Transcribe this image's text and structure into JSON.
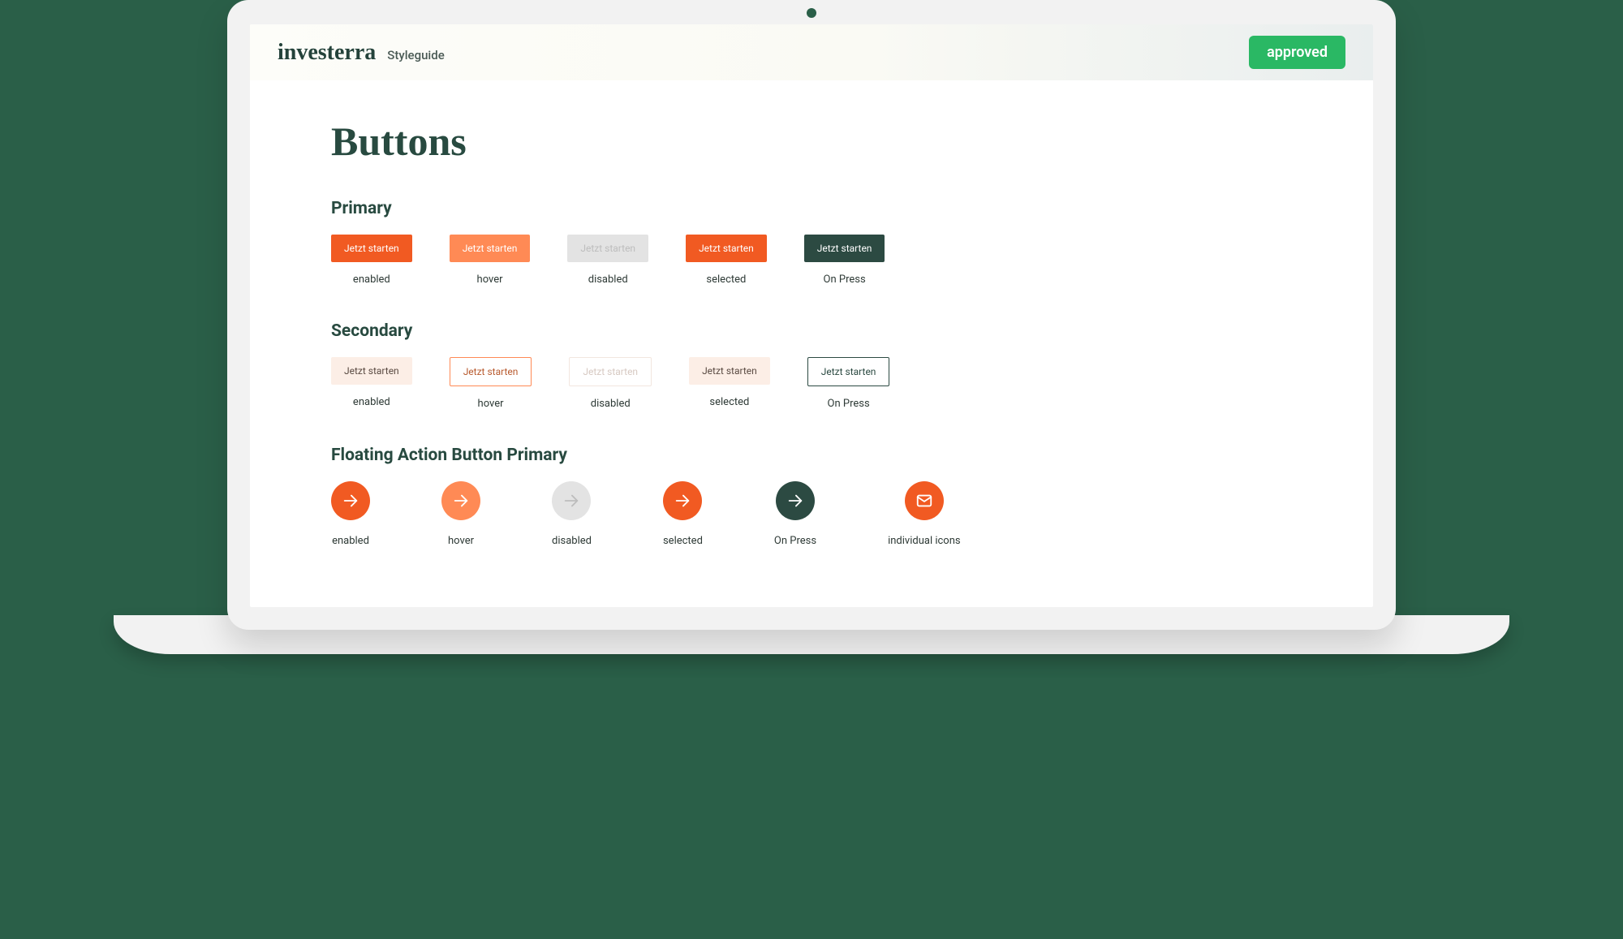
{
  "header": {
    "brand": "investerra",
    "sub": "Styleguide",
    "badge": "approved"
  },
  "title": "Buttons",
  "button_label": "Jetzt starten",
  "sections": {
    "primary": {
      "title": "Primary",
      "states": [
        "enabled",
        "hover",
        "disabled",
        "selected",
        "On Press"
      ]
    },
    "secondary": {
      "title": "Secondary",
      "states": [
        "enabled",
        "hover",
        "disabled",
        "selected",
        "On Press"
      ]
    },
    "fab": {
      "title": "Floating Action Button Primary",
      "states": [
        "enabled",
        "hover",
        "disabled",
        "selected",
        "On Press",
        "individual icons"
      ]
    }
  },
  "colors": {
    "accent_orange": "#f15a22",
    "accent_orange_light": "#ff8a55",
    "disabled_bg": "#e3e3e3",
    "deep_green": "#2c4a42",
    "secondary_bg": "#fceee6",
    "badge_green": "#2ab864"
  }
}
